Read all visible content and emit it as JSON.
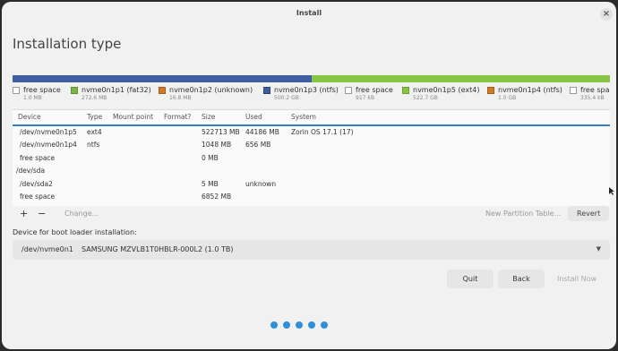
{
  "window": {
    "title": "Install",
    "close_label": "×"
  },
  "page_title": "Installation type",
  "partition_bar": {
    "blue_color": "#3d5ea2",
    "green_color": "#86c441",
    "blue_fraction": 0.5,
    "green_fraction": 0.5
  },
  "legend": [
    {
      "label": "free space",
      "size": "1.0 MB",
      "swatch": "free"
    },
    {
      "label": "nvme0n1p1 (fat32)",
      "size": "272.6 MB",
      "swatch": "fat"
    },
    {
      "label": "nvme0n1p2 (unknown)",
      "size": "16.8 MB",
      "swatch": "unk"
    },
    {
      "label": "nvme0n1p3 (ntfs)",
      "size": "500.2 GB",
      "swatch": "ntfs"
    },
    {
      "label": "free space",
      "size": "917 kB",
      "swatch": "free"
    },
    {
      "label": "nvme0n1p5 (ext4)",
      "size": "522.7 GB",
      "swatch": "ext4"
    },
    {
      "label": "nvme0n1p4 (ntfs)",
      "size": "1.0 GB",
      "swatch": "unk"
    },
    {
      "label": "free spa",
      "size": "335.4 kB",
      "swatch": "free"
    }
  ],
  "table": {
    "headers": {
      "device": "Device",
      "type": "Type",
      "mount": "Mount point",
      "format": "Format?",
      "size": "Size",
      "used": "Used",
      "system": "System"
    },
    "rows": [
      {
        "device": "/dev/nvme0n1p5",
        "type": "ext4",
        "size": "522713 MB",
        "used": "44186 MB",
        "system": "Zorin OS 17.1 (17)"
      },
      {
        "device": "/dev/nvme0n1p4",
        "type": "ntfs",
        "size": "1048 MB",
        "used": "656 MB",
        "system": ""
      },
      {
        "device": "free space",
        "type": "",
        "size": "0 MB",
        "used": "",
        "system": ""
      },
      {
        "device": "/dev/sda",
        "type": "",
        "size": "",
        "used": "",
        "system": ""
      },
      {
        "device": "/dev/sda2",
        "type": "",
        "size": "5 MB",
        "used": "unknown",
        "system": ""
      },
      {
        "device": "free space",
        "type": "",
        "size": "6852 MB",
        "used": "",
        "system": ""
      }
    ]
  },
  "tools": {
    "add": "+",
    "remove": "−",
    "change": "Change...",
    "new_table": "New Partition Table...",
    "revert": "Revert"
  },
  "boot": {
    "label": "Device for boot loader installation:",
    "device": "/dev/nvme0n1",
    "model": "SAMSUNG MZVLB1T0HBLR-000L2 (1.0 TB)",
    "arrow": "▼"
  },
  "buttons": {
    "quit": "Quit",
    "back": "Back",
    "install": "Install Now"
  },
  "progress_dots": 5
}
